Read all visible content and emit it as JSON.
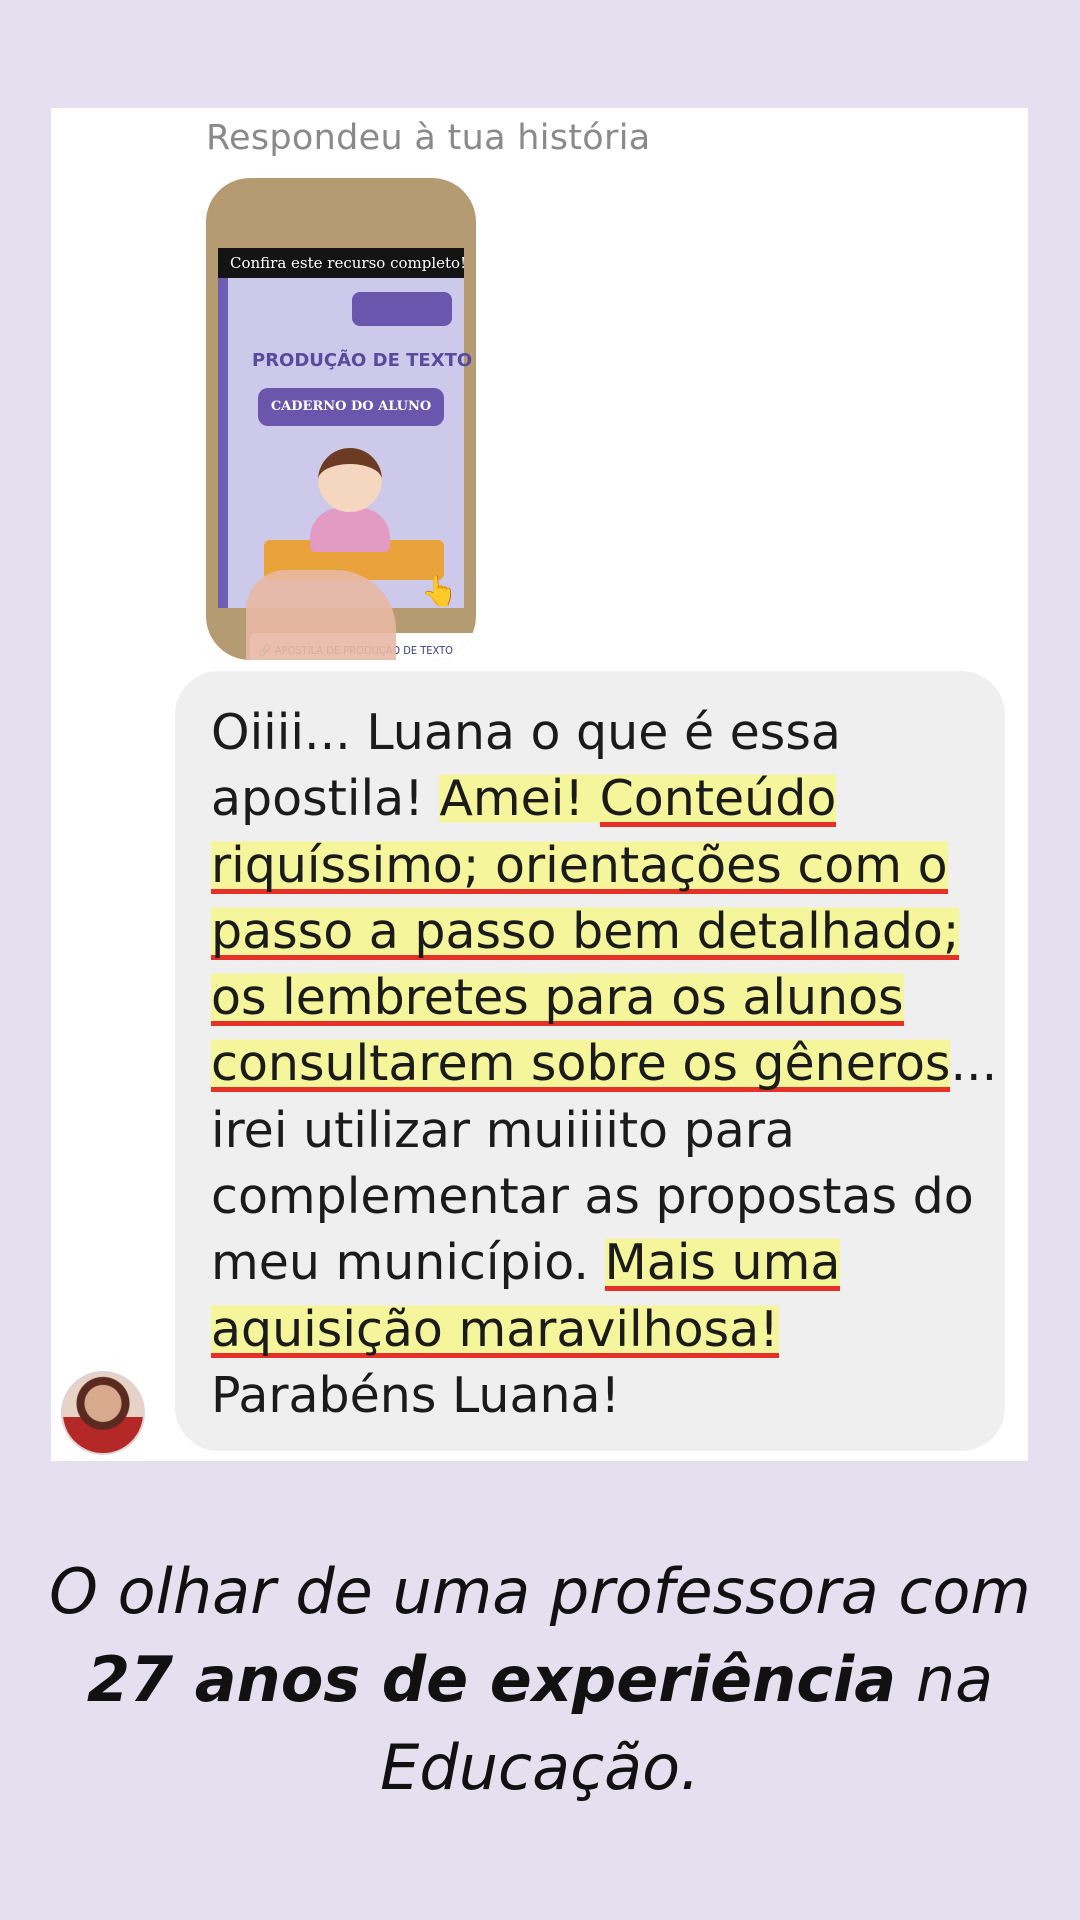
{
  "story_reply": {
    "label": "Respondeu à tua história",
    "thumbnail": {
      "banner": "Confira este recurso completo!",
      "title": "PRODUÇÃO DE TEXTO",
      "subtitle": "CADERNO DO ALUNO",
      "link_text": "APOSTILA DE PRODUÇÃO DE TEXTO"
    }
  },
  "message": {
    "segments": [
      {
        "text": "Oiiii... Luana o que é  essa apostila! ",
        "style": "plain"
      },
      {
        "text": "Amei! ",
        "style": "highlight"
      },
      {
        "text": "Conteúdo riquíssimo; orientações com o passo a passo bem detalhado;  os lembretes para os alunos consultarem sobre os gêneros",
        "style": "highlight-underline"
      },
      {
        "text": "... irei utilizar muiiiito para complementar as propostas do meu município.  ",
        "style": "plain"
      },
      {
        "text": "Mais uma aquisição maravilhosa!",
        "style": "highlight-underline"
      },
      {
        "text": " Parabéns Luana!",
        "style": "plain"
      }
    ]
  },
  "caption": {
    "part1": "O olhar de uma professora com ",
    "bold": "27 anos de experiência",
    "part2": " na Educação."
  },
  "colors": {
    "background": "#e4e0f0",
    "bubble": "#efefef",
    "highlight": "#f6f68c",
    "underline": "#e53128"
  }
}
